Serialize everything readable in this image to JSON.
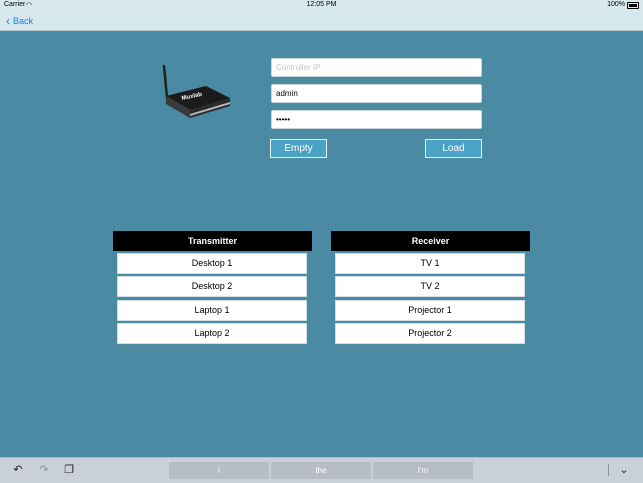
{
  "status_bar": {
    "carrier": "Carrier",
    "time": "12:05 PM",
    "battery": "100%"
  },
  "nav": {
    "back_label": "Back"
  },
  "login": {
    "ip_placeholder": "Controller IP",
    "ip_value": "",
    "username_value": "admin",
    "password_value": "•••••",
    "empty_label": "Empty",
    "load_label": "Load"
  },
  "device": {
    "brand_text": "Muxlab"
  },
  "transmitter": {
    "header": "Transmitter",
    "items": [
      "Desktop 1",
      "Desktop 2",
      "Laptop 1",
      "Laptop 2"
    ]
  },
  "receiver": {
    "header": "Receiver",
    "items": [
      "TV 1",
      "TV 2",
      "Projector 1",
      "Projector 2"
    ]
  },
  "keyboard_bar": {
    "suggestions": [
      "I",
      "the",
      "I'm"
    ],
    "icons": [
      "undo-icon",
      "redo-icon",
      "paste-icon",
      "keyboard-dismiss-icon"
    ]
  },
  "colors": {
    "background": "#4a8ba3",
    "accent_button": "#4aa3c4",
    "nav_bar": "#d7e8ef",
    "ios_blue": "#1a7cf2"
  }
}
